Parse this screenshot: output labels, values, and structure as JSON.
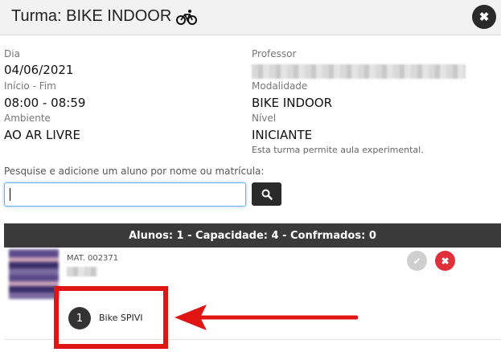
{
  "header": {
    "title": "Turma: BIKE INDOOR",
    "icon": "bicycle-icon"
  },
  "close_icon": "close-icon",
  "fields": {
    "dia_label": "Dia",
    "dia_value": "04/06/2021",
    "horario_label": "Início - Fim",
    "horario_value": "08:00 - 08:59",
    "ambiente_label": "Ambiente",
    "ambiente_value": "AO AR LIVRE",
    "professor_label": "Professor",
    "modalidade_label": "Modalidade",
    "modalidade_value": "BIKE INDOOR",
    "nivel_label": "Nível",
    "nivel_value": "INICIANTE",
    "nota": "Esta turma permite aula experimental."
  },
  "search": {
    "label": "Pesquise e adicione um aluno por nome ou matrícula:",
    "value": "",
    "icon": "search-icon"
  },
  "students_bar": {
    "text": "Alunos: 1 - Capacidade: 4 - Confrmados: 0"
  },
  "student": {
    "mat": "MAT. 002371"
  },
  "slot": {
    "number": "1",
    "label": "Bike SPIVI"
  },
  "colors": {
    "accent_red": "#e11414",
    "dark": "#2a2a2a",
    "remove": "#e0303a"
  }
}
